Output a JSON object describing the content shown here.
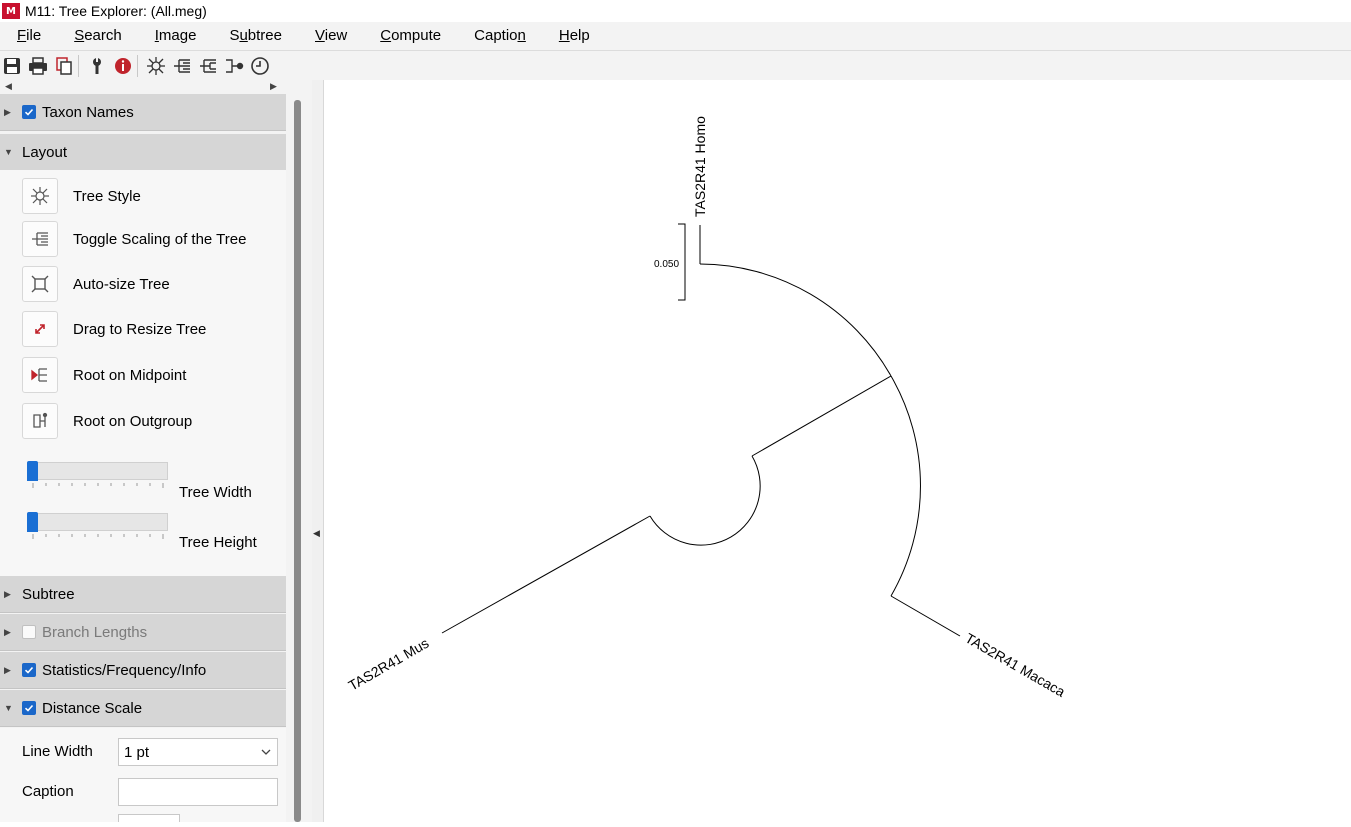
{
  "window": {
    "title": "M11: Tree Explorer: (All.meg)",
    "logo_text": "M"
  },
  "menu": [
    {
      "pre": "",
      "ul": "F",
      "post": "ile"
    },
    {
      "pre": "",
      "ul": "S",
      "post": "earch"
    },
    {
      "pre": "",
      "ul": "I",
      "post": "mage"
    },
    {
      "pre": "S",
      "ul": "u",
      "post": "btree"
    },
    {
      "pre": "",
      "ul": "V",
      "post": "iew"
    },
    {
      "pre": "",
      "ul": "C",
      "post": "ompute"
    },
    {
      "pre": "Captio",
      "ul": "n",
      "post": ""
    },
    {
      "pre": "",
      "ul": "H",
      "post": "elp"
    }
  ],
  "toolbar": {
    "icons": [
      "save-icon",
      "print-icon",
      "copy-icon",
      "wrench-icon",
      "info-icon",
      "tree-style-icon",
      "scale-toggle-icon",
      "subtree-icon",
      "root-icon",
      "clock-icon"
    ]
  },
  "panel": {
    "taxon_names": {
      "label": "Taxon Names",
      "checked": true
    },
    "layout": {
      "label": "Layout"
    },
    "layout_items": [
      {
        "label": "Tree Style",
        "icon": "tree-style-icon"
      },
      {
        "label": "Toggle Scaling of the Tree",
        "icon": "toggle-scaling-icon"
      },
      {
        "label": "Auto-size Tree",
        "icon": "auto-size-icon"
      },
      {
        "label": "Drag to Resize Tree",
        "icon": "drag-resize-icon"
      },
      {
        "label": "Root on Midpoint",
        "icon": "root-midpoint-icon"
      },
      {
        "label": "Root on Outgroup",
        "icon": "root-outgroup-icon"
      }
    ],
    "tree_width": {
      "label": "Tree Width",
      "level": 0
    },
    "tree_height": {
      "label": "Tree Height",
      "level": 0
    },
    "subtree": {
      "label": "Subtree"
    },
    "branch_lengths": {
      "label": "Branch Lengths",
      "checked": false
    },
    "statistics": {
      "label": "Statistics/Frequency/Info",
      "checked": true
    },
    "distance_scale": {
      "label": "Distance Scale",
      "checked": true
    },
    "line_width": {
      "label": "Line Width",
      "value": "1 pt"
    },
    "caption": {
      "label": "Caption",
      "value": ""
    }
  },
  "tree": {
    "taxa": [
      "TAS2R41 Homo",
      "TAS2R41 Mus",
      "TAS2R41 Macaca"
    ],
    "scale_label": "0.050"
  },
  "colors": {
    "accent": "#1a67c9",
    "header": "#d6d6d6",
    "info_red": "#c0242c"
  }
}
